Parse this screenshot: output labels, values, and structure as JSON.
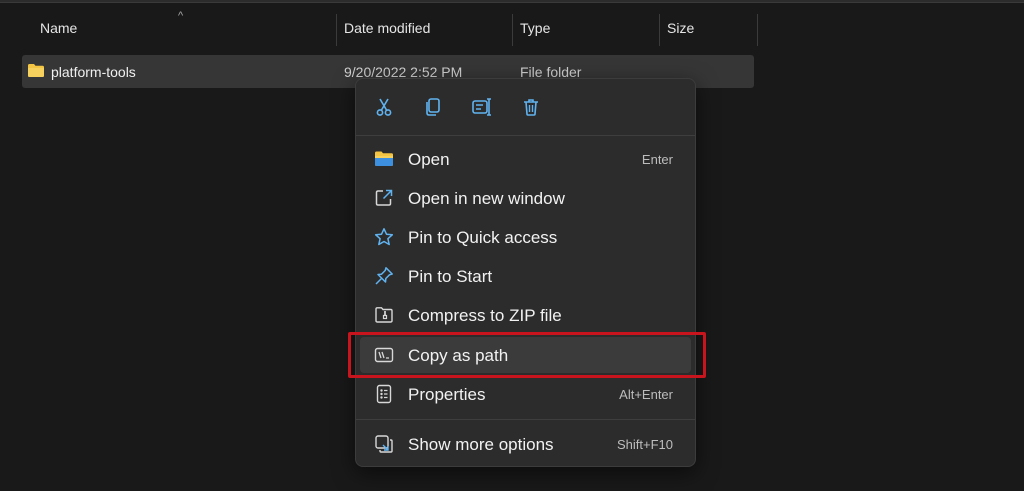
{
  "columns": {
    "name": "Name",
    "date_modified": "Date modified",
    "type": "Type",
    "size": "Size"
  },
  "sort_indicator": "^",
  "file": {
    "name": "platform-tools",
    "date": "9/20/2022 2:52 PM",
    "type": "File folder",
    "icon": "folder-icon"
  },
  "toolbar": {
    "cut_icon": "scissors-icon",
    "copy_icon": "copy-icon",
    "rename_icon": "rename-icon",
    "delete_icon": "trash-icon"
  },
  "menu": {
    "items": [
      {
        "label": "Open",
        "shortcut": "Enter",
        "icon": "folder-icon"
      },
      {
        "label": "Open in new window",
        "shortcut": "",
        "icon": "open-external-icon"
      },
      {
        "label": "Pin to Quick access",
        "shortcut": "",
        "icon": "star-icon"
      },
      {
        "label": "Pin to Start",
        "shortcut": "",
        "icon": "pin-icon"
      },
      {
        "label": "Compress to ZIP file",
        "shortcut": "",
        "icon": "zip-folder-icon"
      },
      {
        "label": "Copy as path",
        "shortcut": "",
        "icon": "path-icon",
        "highlighted": true
      },
      {
        "label": "Properties",
        "shortcut": "Alt+Enter",
        "icon": "properties-icon"
      },
      {
        "label": "Show more options",
        "shortcut": "Shift+F10",
        "icon": "more-options-icon"
      }
    ]
  },
  "colors": {
    "background": "#191919",
    "menu_bg": "#2c2c2c",
    "accent_blue": "#60b3f0",
    "folder_yellow": "#f4c542",
    "highlight_red": "#c8141c"
  }
}
